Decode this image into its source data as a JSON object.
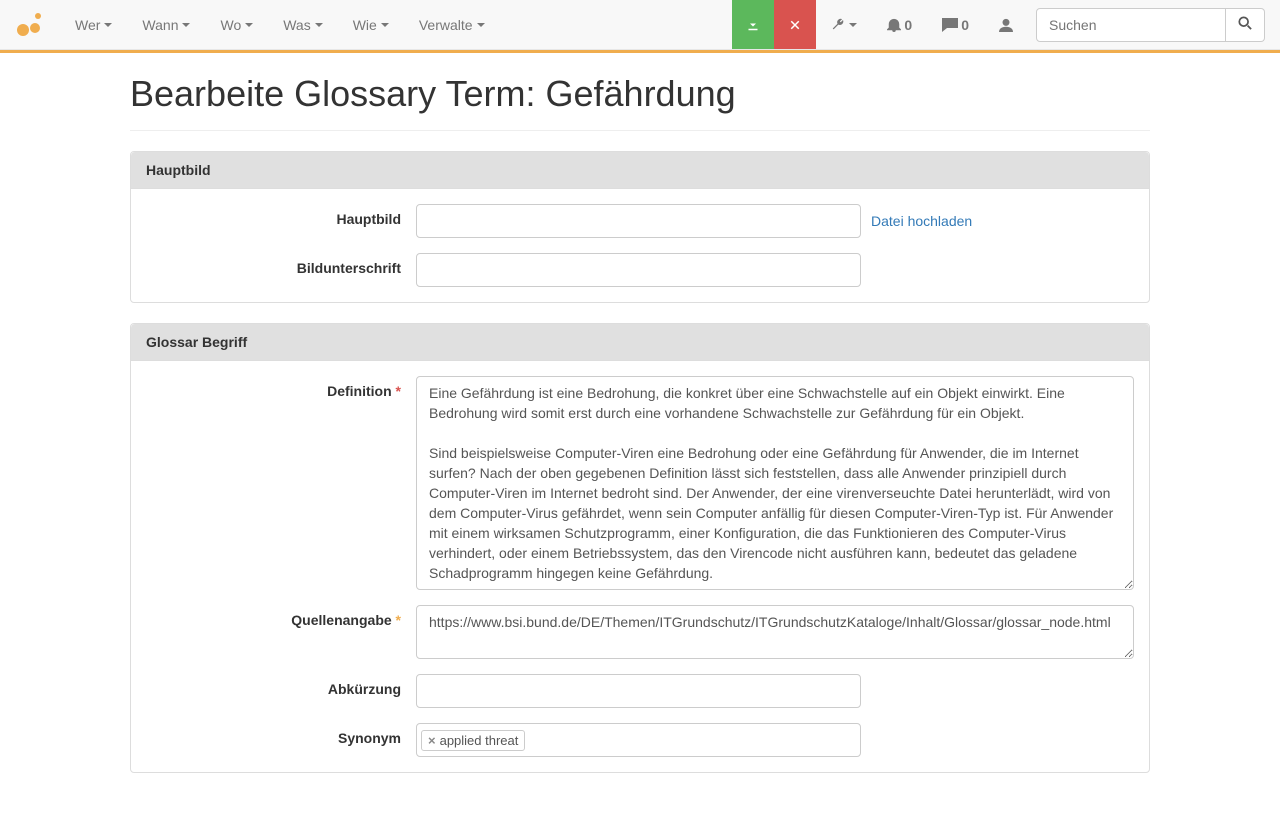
{
  "nav": {
    "items": [
      "Wer",
      "Wann",
      "Wo",
      "Was",
      "Wie",
      "Verwalte"
    ],
    "bell_count": "0",
    "comment_count": "0"
  },
  "search": {
    "placeholder": "Suchen"
  },
  "page": {
    "title": "Bearbeite Glossary Term: Gefährdung"
  },
  "panel1": {
    "title": "Hauptbild",
    "label_hauptbild": "Hauptbild",
    "upload_link": "Datei hochladen",
    "label_caption": "Bildunterschrift"
  },
  "panel2": {
    "title": "Glossar Begriff",
    "label_definition": "Definition",
    "value_definition": "Eine Gefährdung ist eine Bedrohung, die konkret über eine Schwachstelle auf ein Objekt einwirkt. Eine Bedrohung wird somit erst durch eine vorhandene Schwachstelle zur Gefährdung für ein Objekt.\n\nSind beispielsweise Computer-Viren eine Bedrohung oder eine Gefährdung für Anwender, die im Internet surfen? Nach der oben gegebenen Definition lässt sich feststellen, dass alle Anwender prinzipiell durch Computer-Viren im Internet bedroht sind. Der Anwender, der eine virenverseuchte Datei herunterlädt, wird von dem Computer-Virus gefährdet, wenn sein Computer anfällig für diesen Computer-Viren-Typ ist. Für Anwender mit einem wirksamen Schutzprogramm, einer Konfiguration, die das Funktionieren des Computer-Virus verhindert, oder einem Betriebssystem, das den Virencode nicht ausführen kann, bedeutet das geladene Schadprogramm hingegen keine Gefährdung.",
    "label_source": "Quellenangabe",
    "value_source": "https://www.bsi.bund.de/DE/Themen/ITGrundschutz/ITGrundschutzKataloge/Inhalt/Glossar/glossar_node.html",
    "label_abbr": "Abkürzung",
    "label_synonym": "Synonym",
    "synonym_tag": "applied threat"
  }
}
